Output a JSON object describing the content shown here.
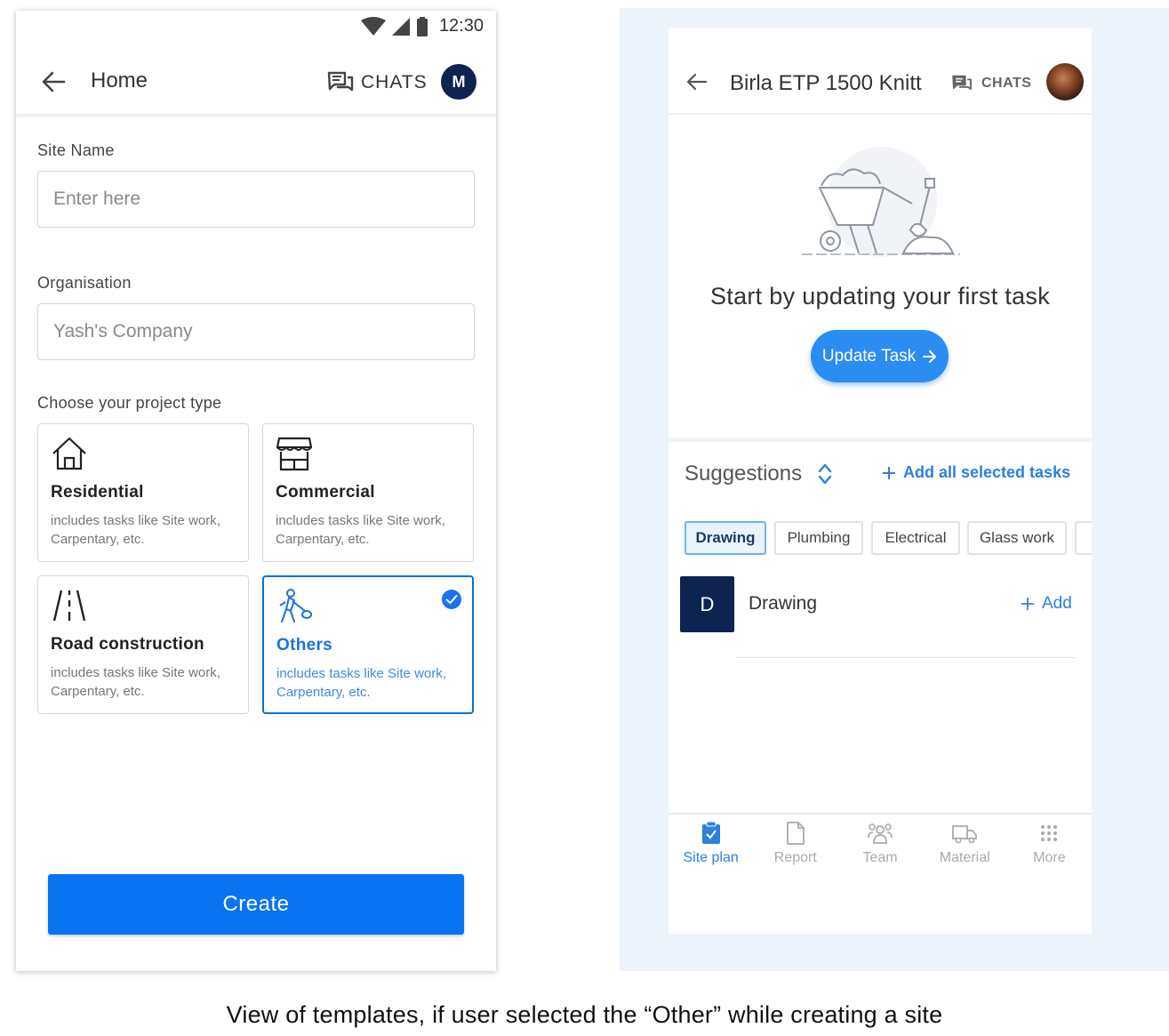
{
  "left_screen": {
    "status_bar": {
      "time": "12:30"
    },
    "header": {
      "title": "Home",
      "chats_label": "CHATS",
      "avatar_initial": "M"
    },
    "form": {
      "site_name": {
        "label": "Site Name",
        "placeholder": "Enter here"
      },
      "organisation": {
        "label": "Organisation",
        "value": "Yash's Company"
      },
      "project_type_label": "Choose your project type",
      "project_types": [
        {
          "title": "Residential",
          "description": "includes tasks like Site work, Carpentary, etc.",
          "icon": "house-icon",
          "selected": false
        },
        {
          "title": "Commercial",
          "description": "includes tasks like Site work, Carpentary, etc.",
          "icon": "storefront-icon",
          "selected": false
        },
        {
          "title": "Road construction",
          "description": "includes tasks like Site work, Carpentary, etc.",
          "icon": "road-icon",
          "selected": false
        },
        {
          "title": "Others",
          "description": "includes tasks like Site work, Carpentary, etc.",
          "icon": "worker-icon",
          "selected": true
        }
      ],
      "create_button": "Create"
    }
  },
  "right_screen": {
    "header": {
      "title": "Birla ETP 1500 Knitt",
      "chats_label": "CHATS"
    },
    "empty_state": {
      "title": "Start by updating your first task",
      "button": "Update Task"
    },
    "suggestions": {
      "title": "Suggestions",
      "add_all_label": "Add all selected tasks",
      "chips": [
        "Drawing",
        "Plumbing",
        "Electrical",
        "Glass work"
      ],
      "active_chip": "Drawing",
      "task": {
        "initial": "D",
        "name": "Drawing",
        "add_label": "Add"
      }
    },
    "bottom_nav": [
      {
        "label": "Site plan",
        "icon": "clipboard-check-icon",
        "active": true
      },
      {
        "label": "Report",
        "icon": "document-icon",
        "active": false
      },
      {
        "label": "Team",
        "icon": "team-icon",
        "active": false
      },
      {
        "label": "Material",
        "icon": "truck-icon",
        "active": false
      },
      {
        "label": "More",
        "icon": "grid-dots-icon",
        "active": false
      }
    ]
  },
  "caption": "View of templates, if user selected the “Other” while creating a site",
  "colors": {
    "primary": "#0a73f2",
    "navy": "#0d2350",
    "accent_blue": "#2b80e0",
    "panel_bg": "#eef4fc"
  }
}
